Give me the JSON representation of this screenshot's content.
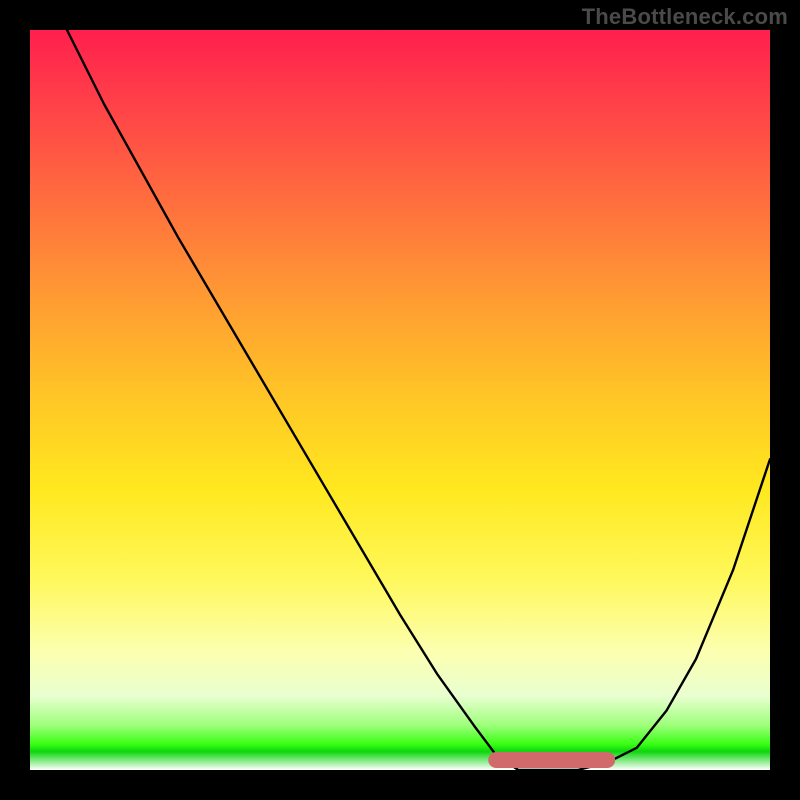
{
  "watermark": "TheBottleneck.com",
  "chart_data": {
    "type": "line",
    "title": "",
    "xlabel": "",
    "ylabel": "",
    "xlim": [
      0,
      100
    ],
    "ylim": [
      0,
      100
    ],
    "grid": false,
    "series": [
      {
        "name": "bottleneck-curve",
        "x": [
          5,
          10,
          20,
          30,
          40,
          50,
          55,
          60,
          63,
          66,
          70,
          74,
          78,
          82,
          86,
          90,
          95,
          100
        ],
        "values": [
          100,
          90,
          72,
          55,
          38,
          21,
          13,
          6,
          2,
          0,
          0,
          0,
          1,
          3,
          8,
          15,
          27,
          42
        ]
      }
    ],
    "markers": [
      {
        "name": "flat-segment",
        "x0": 63,
        "x1": 78,
        "y": 0,
        "color": "#d16a6a",
        "radius": 8
      }
    ],
    "background_gradient": {
      "direction": "vertical",
      "stops": [
        {
          "pos": 0.0,
          "color": "#ff1f4d"
        },
        {
          "pos": 0.22,
          "color": "#ff6a3f"
        },
        {
          "pos": 0.5,
          "color": "#ffc726"
        },
        {
          "pos": 0.74,
          "color": "#fff85a"
        },
        {
          "pos": 0.9,
          "color": "#e9ffd0"
        },
        {
          "pos": 0.965,
          "color": "#39ff14"
        },
        {
          "pos": 1.0,
          "color": "#ffffff"
        }
      ]
    }
  }
}
